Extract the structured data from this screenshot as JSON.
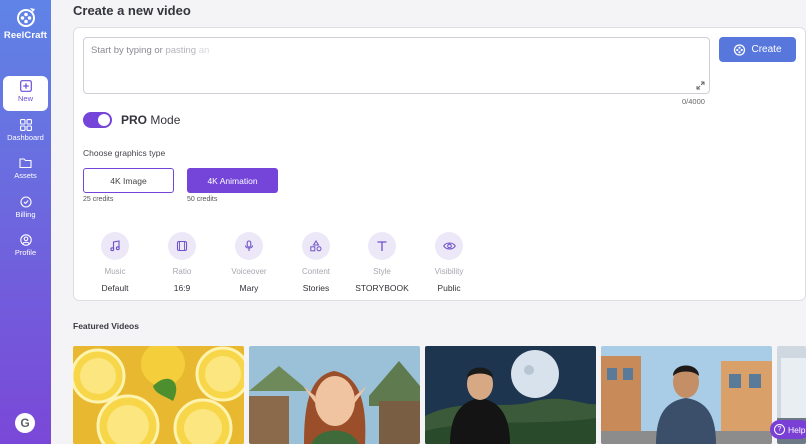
{
  "app": {
    "name": "ReelCraft"
  },
  "sidebar": {
    "items": [
      {
        "label": "New",
        "icon": "plus-square-icon",
        "active": true
      },
      {
        "label": "Dashboard",
        "icon": "grid-icon"
      },
      {
        "label": "Assets",
        "icon": "folder-icon"
      },
      {
        "label": "Billing",
        "icon": "billing-icon"
      },
      {
        "label": "Profile",
        "icon": "user-circle-icon"
      }
    ],
    "avatar_letter": "G"
  },
  "main": {
    "title": "Create a new video",
    "prompt": {
      "text_main": "Start by typing or",
      "text_fade1": "pasting",
      "text_fade2": "an",
      "counter": "0/4000"
    },
    "create_button": "Create",
    "pro_mode": {
      "bold": "PRO",
      "rest": " Mode",
      "enabled": true
    },
    "graphics": {
      "label": "Choose graphics type",
      "options": [
        {
          "label": "4K Image",
          "credits": "25 credits",
          "selected": false
        },
        {
          "label": "4K Animation",
          "credits": "50 credits",
          "selected": true
        }
      ]
    },
    "settings": [
      {
        "label": "Music",
        "value": "Default",
        "icon": "music-note-icon"
      },
      {
        "label": "Ratio",
        "value": "16:9",
        "icon": "ratio-icon"
      },
      {
        "label": "Voiceover",
        "value": "Mary",
        "icon": "microphone-icon"
      },
      {
        "label": "Content",
        "value": "Stories",
        "icon": "shapes-icon"
      },
      {
        "label": "Style",
        "value": "STORYBOOK",
        "icon": "text-t-icon"
      },
      {
        "label": "Visibility",
        "value": "Public",
        "icon": "eye-icon"
      }
    ]
  },
  "featured": {
    "label": "Featured Videos"
  },
  "help": {
    "label": "Help"
  },
  "colors": {
    "accent": "#7445d8",
    "create_blue": "#5877dc",
    "sidebar_top": "#5f84e6",
    "sidebar_bottom": "#7a48d8"
  }
}
